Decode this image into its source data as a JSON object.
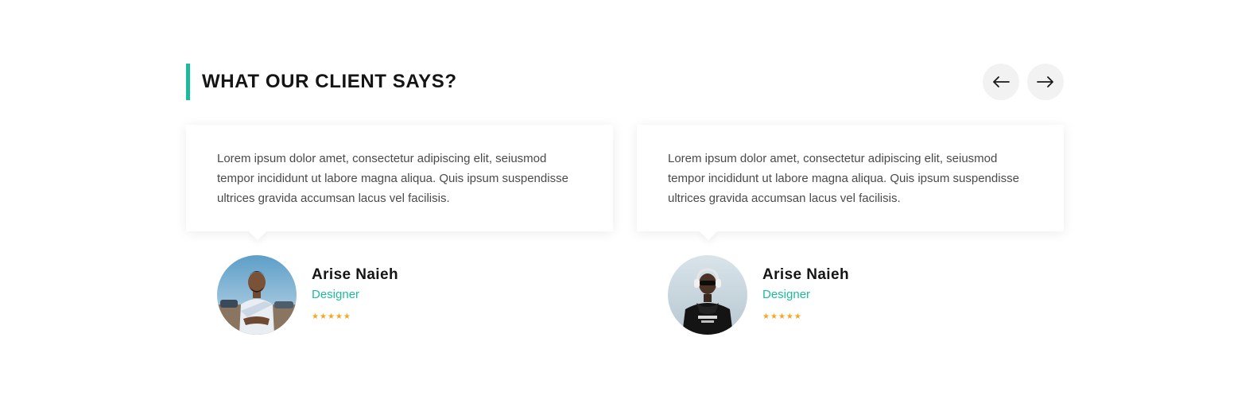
{
  "section": {
    "title": "WHAT OUR CLIENT SAYS?",
    "accent_color": "#1bbc9b",
    "nav": {
      "prev_icon": "arrow-left-icon",
      "next_icon": "arrow-right-icon"
    }
  },
  "testimonials": [
    {
      "quote": "Lorem ipsum dolor amet, consectetur adipiscing elit, seiusmod tempor incididunt ut labore magna aliqua. Quis ipsum suspendisse ultrices gravida accumsan lacus vel facilisis.",
      "name": "Arise Naieh",
      "role": "Designer",
      "rating": 5,
      "rating_max": 5
    },
    {
      "quote": "Lorem ipsum dolor amet, consectetur adipiscing elit, seiusmod tempor incididunt ut labore magna aliqua. Quis ipsum suspendisse ultrices gravida accumsan lacus vel facilisis.",
      "name": "Arise Naieh",
      "role": "Designer",
      "rating": 5,
      "rating_max": 5
    }
  ],
  "colors": {
    "star": "#f5a623",
    "role": "#1bbc9b",
    "nav_bg": "#f2f2f2"
  }
}
